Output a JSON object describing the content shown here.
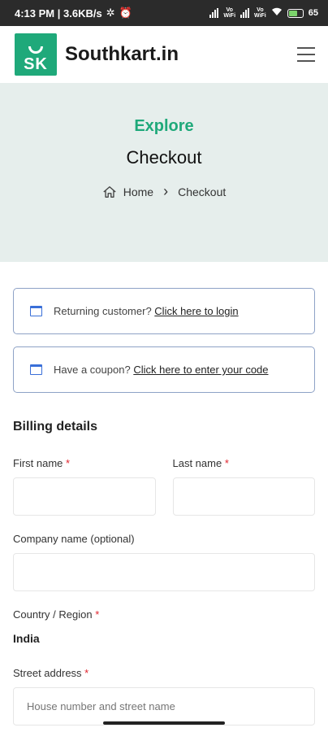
{
  "status_bar": {
    "time_network": "4:13 PM | 3.6KB/s",
    "volte1": "Vo\nWiFi",
    "volte2": "Vo\nWiFi",
    "battery": "65"
  },
  "header": {
    "logo_text": "SK",
    "brand_name": "Southkart.in"
  },
  "hero": {
    "subtitle": "Explore",
    "title": "Checkout",
    "breadcrumb_home": "Home",
    "breadcrumb_separator": "›",
    "breadcrumb_current": "Checkout"
  },
  "notices": {
    "login_text": "Returning customer?",
    "login_link": "Click here to login",
    "coupon_text": "Have a coupon?",
    "coupon_link": "Click here to enter your code"
  },
  "billing": {
    "title": "Billing details",
    "first_name_label": "First name",
    "last_name_label": "Last name",
    "company_label": "Company name (optional)",
    "country_label": "Country / Region",
    "country_value": "India",
    "street_label": "Street address",
    "street_placeholder": "House number and street name",
    "required_mark": "*"
  },
  "colors": {
    "brand_green": "#1fa97a",
    "hero_bg": "#e6eeec",
    "notice_border": "#8ea2c6",
    "required": "#e0242d"
  }
}
